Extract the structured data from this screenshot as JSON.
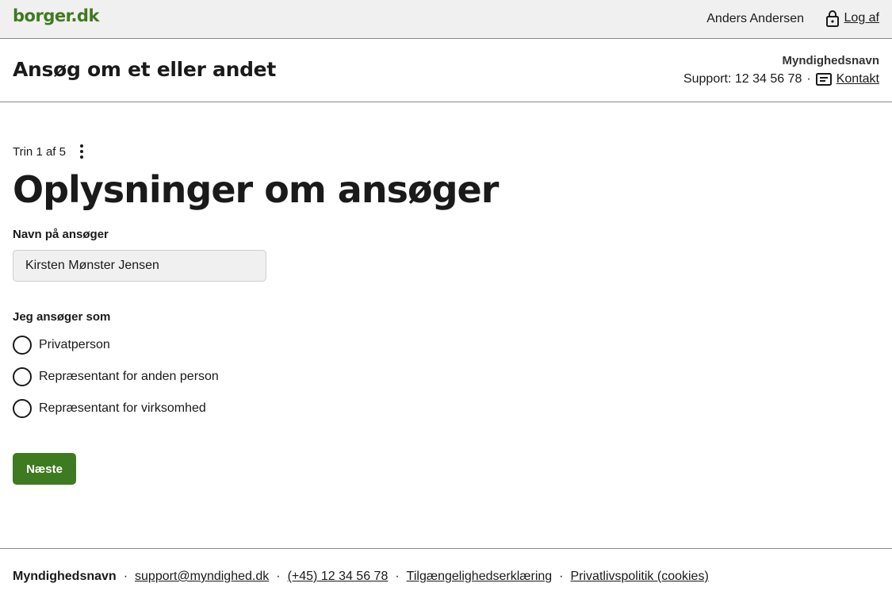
{
  "topbar": {
    "logo": "borger.dk",
    "user_name": "Anders Andersen",
    "logout_label": "Log af"
  },
  "header": {
    "title": "Ansøg om et eller andet",
    "authority": "Myndighedsnavn",
    "support_text": "Support: 12 34 56 78",
    "separator": "·",
    "contact_label": "Kontakt"
  },
  "main": {
    "step_text": "Trin 1 af 5",
    "page_title": "Oplysninger om ansøger",
    "name_label": "Navn på ansøger",
    "name_value": "Kirsten Mønster Jensen",
    "applicant_label": "Jeg ansøger som",
    "options": [
      {
        "label": "Privatperson"
      },
      {
        "label": "Repræsentant for anden person"
      },
      {
        "label": "Repræsentant for virksomhed"
      }
    ],
    "next_label": "Næste"
  },
  "footer": {
    "authority": "Myndighedsnavn",
    "separator": "·",
    "email": "support@myndighed.dk",
    "phone": "(+45) 12 34 56 78",
    "accessibility": "Tilgængelighedserklæring",
    "privacy": "Privatlivspolitik (cookies)"
  },
  "colors": {
    "brand_green": "#3e7a1f",
    "topbar_bg": "#f0f0f0",
    "input_bg": "#f0f0f0"
  },
  "icons": [
    "lock-icon",
    "contact-card-icon",
    "kebab-menu-icon",
    "radio-icon"
  ]
}
